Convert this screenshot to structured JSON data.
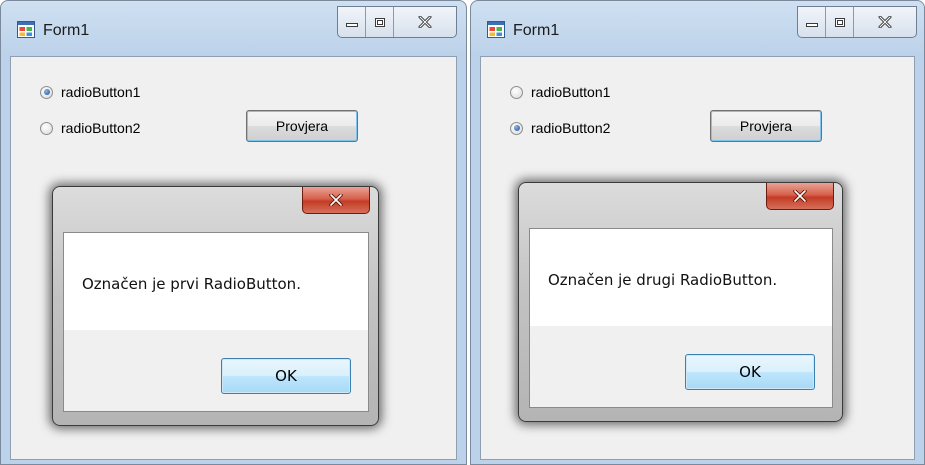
{
  "windows": [
    {
      "title": "Form1",
      "radio1": {
        "label": "radioButton1",
        "checked": true
      },
      "radio2": {
        "label": "radioButton2",
        "checked": false
      },
      "button_label": "Provjera",
      "dialog": {
        "message": "Označen je prvi RadioButton.",
        "ok_label": "OK"
      }
    },
    {
      "title": "Form1",
      "radio1": {
        "label": "radioButton1",
        "checked": false
      },
      "radio2": {
        "label": "radioButton2",
        "checked": true
      },
      "button_label": "Provjera",
      "dialog": {
        "message": "Označen je drugi RadioButton.",
        "ok_label": "OK"
      }
    }
  ],
  "icons": {
    "app": "windows-form-icon",
    "minimize": "minimize-icon",
    "maximize": "maximize-icon",
    "close": "close-icon",
    "radio": "radio-button-icon"
  },
  "colors": {
    "title_bar": "#bcd2ea",
    "client": "#f0f0f0",
    "dialog_close": "#c43b24",
    "ok_button": "#bee6fd",
    "radio_dot": "#1c4f9c"
  }
}
